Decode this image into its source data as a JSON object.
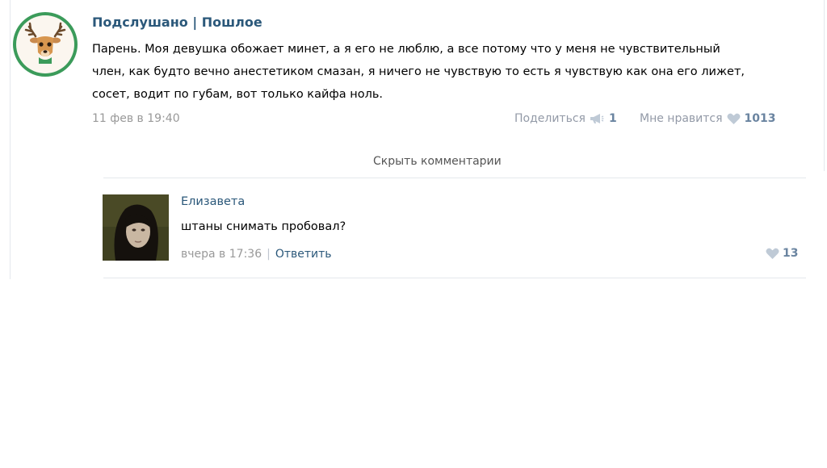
{
  "post": {
    "author": "Подслушано | Пошлое",
    "text_lines": [
      "Парень. Моя девушка обожает минет, а я его не люблю, а все потому что у меня не чувствительный",
      "член, как будто вечно анестетиком смазан, я ничего не чувствую то есть я чувствую как она его лижет,",
      "сосет, водит по губам, вот только кайфа ноль."
    ],
    "date": "11 фев в 19:40",
    "share_label": "Поделиться",
    "share_count": "1",
    "like_label": "Мне нравится",
    "like_count": "1013",
    "avatar_icon": "deer-icon"
  },
  "comments_toggle": "Скрыть комментарии",
  "comment": {
    "author": "Елизавета",
    "text": "штаны снимать пробовал?",
    "date": "вчера в 17:36",
    "separator": "|",
    "reply_label": "Ответить",
    "like_count": "13"
  },
  "colors": {
    "link": "#2b587a",
    "muted": "#999999",
    "icon": "#bfcad6",
    "avatar_ring": "#3b9b5a"
  }
}
